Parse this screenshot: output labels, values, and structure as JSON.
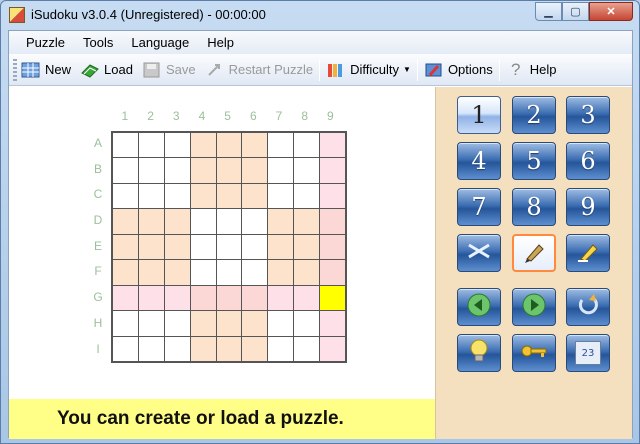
{
  "window": {
    "title": "iSudoku v3.0.4 (Unregistered) - 00:00:00",
    "controls": {
      "minimize": "▁",
      "maximize": "▢",
      "close": "✕"
    }
  },
  "menu": [
    "Puzzle",
    "Tools",
    "Language",
    "Help"
  ],
  "toolbar": {
    "new": "New",
    "load": "Load",
    "save": "Save",
    "restart": "Restart Puzzle",
    "difficulty": "Difficulty",
    "options": "Options",
    "help": "Help"
  },
  "board": {
    "col_labels": [
      "1",
      "2",
      "3",
      "4",
      "5",
      "6",
      "7",
      "8",
      "9"
    ],
    "row_labels": [
      "A",
      "B",
      "C",
      "D",
      "E",
      "F",
      "G",
      "H",
      "I"
    ],
    "selected_cell": "G9"
  },
  "message": "You can create or load a puzzle.",
  "panel": {
    "numbers": [
      "1",
      "2",
      "3",
      "4",
      "5",
      "6",
      "7",
      "8",
      "9"
    ],
    "active_number": "1",
    "tools": [
      "erase-icon",
      "pen-icon",
      "pencil-icon"
    ],
    "nav": [
      "back-arrow-icon",
      "forward-arrow-icon",
      "refresh-icon"
    ],
    "extras": [
      "lightbulb-icon",
      "key-icon",
      "candidates-icon"
    ],
    "candidates_label": "23"
  },
  "colors": {
    "highlight_box": "#fde3cc",
    "highlight_row_col": "#fde0e8",
    "selected": "#ffff00",
    "message_bg": "#ffff88",
    "panel_bg": "#f4dfbf"
  }
}
